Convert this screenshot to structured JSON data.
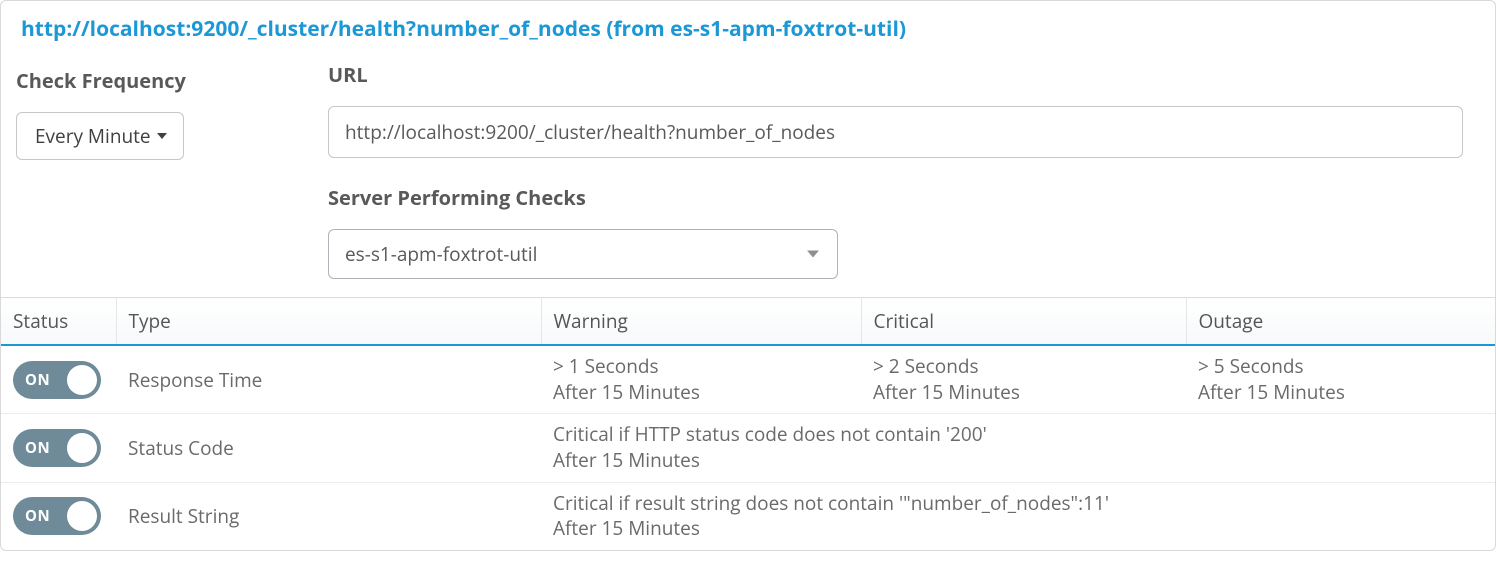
{
  "header": {
    "title": "http://localhost:9200/_cluster/health?number_of_nodes (from es-s1-apm-foxtrot-util)"
  },
  "frequency": {
    "label": "Check Frequency",
    "value": "Every Minute"
  },
  "url": {
    "label": "URL",
    "value": "http://localhost:9200/_cluster/health?number_of_nodes"
  },
  "server": {
    "label": "Server Performing Checks",
    "value": "es-s1-apm-foxtrot-util"
  },
  "table": {
    "columns": {
      "status": "Status",
      "type": "Type",
      "warning": "Warning",
      "critical": "Critical",
      "outage": "Outage"
    },
    "toggle_on": "ON",
    "rows": [
      {
        "type": "Response Time",
        "warning_line1": "> 1 Seconds",
        "warning_line2": "After 15 Minutes",
        "critical_line1": "> 2 Seconds",
        "critical_line2": "After 15 Minutes",
        "outage_line1": "> 5 Seconds",
        "outage_line2": "After 15 Minutes"
      },
      {
        "type": "Status Code",
        "span_line1": "Critical if HTTP status code does not contain '200'",
        "span_line2": "After 15 Minutes"
      },
      {
        "type": "Result String",
        "span_line1": "Critical if result string does not contain '\"number_of_nodes\":11'",
        "span_line2": "After 15 Minutes"
      }
    ]
  }
}
